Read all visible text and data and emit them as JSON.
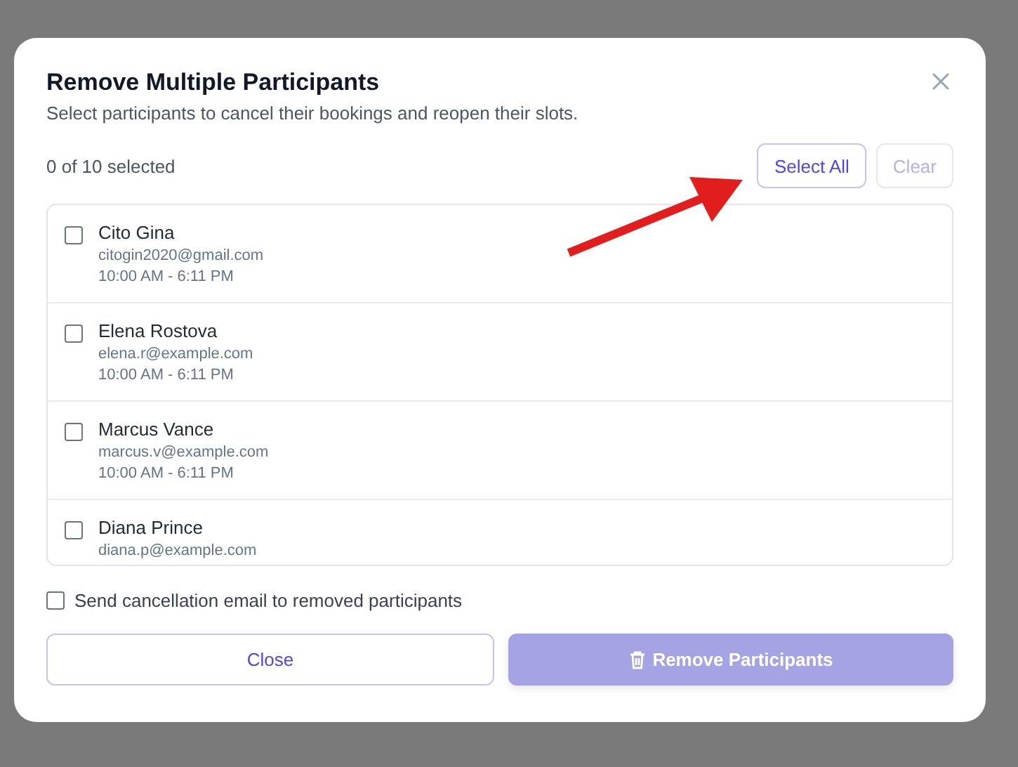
{
  "dialog": {
    "title": "Remove Multiple Participants",
    "subtitle": "Select participants to cancel their bookings and reopen their slots.",
    "selection_count": "0 of 10 selected",
    "actions": [
      {
        "label": "Select All",
        "disabled": false
      },
      {
        "label": "Clear",
        "disabled": true
      }
    ],
    "participants": [
      {
        "name": "Cito Gina",
        "email": "citogin2020@gmail.com",
        "time": "10:00 AM - 6:11 PM",
        "checked": false
      },
      {
        "name": "Elena Rostova",
        "email": "elena.r@example.com",
        "time": "10:00 AM - 6:11 PM",
        "checked": false
      },
      {
        "name": "Marcus Vance",
        "email": "marcus.v@example.com",
        "time": "10:00 AM - 6:11 PM",
        "checked": false
      },
      {
        "name": "Diana Prince",
        "email": "diana.p@example.com",
        "checked": false
      }
    ],
    "send_email": {
      "label": "Send cancellation email to removed participants",
      "checked": false
    },
    "footer": {
      "close": {
        "label": "Close"
      },
      "remove": {
        "label": "Remove Participants",
        "disabled": true
      }
    }
  }
}
